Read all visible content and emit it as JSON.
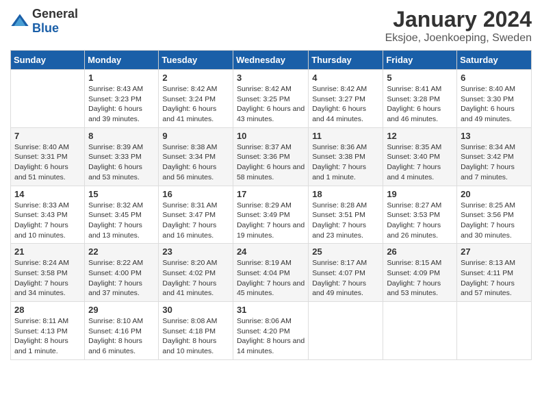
{
  "header": {
    "logo_general": "General",
    "logo_blue": "Blue",
    "month_title": "January 2024",
    "location": "Eksjoe, Joenkoeping, Sweden"
  },
  "weekdays": [
    "Sunday",
    "Monday",
    "Tuesday",
    "Wednesday",
    "Thursday",
    "Friday",
    "Saturday"
  ],
  "weeks": [
    [
      {
        "day": "",
        "sunrise": "",
        "sunset": "",
        "daylight": ""
      },
      {
        "day": "1",
        "sunrise": "Sunrise: 8:43 AM",
        "sunset": "Sunset: 3:23 PM",
        "daylight": "Daylight: 6 hours and 39 minutes."
      },
      {
        "day": "2",
        "sunrise": "Sunrise: 8:42 AM",
        "sunset": "Sunset: 3:24 PM",
        "daylight": "Daylight: 6 hours and 41 minutes."
      },
      {
        "day": "3",
        "sunrise": "Sunrise: 8:42 AM",
        "sunset": "Sunset: 3:25 PM",
        "daylight": "Daylight: 6 hours and 43 minutes."
      },
      {
        "day": "4",
        "sunrise": "Sunrise: 8:42 AM",
        "sunset": "Sunset: 3:27 PM",
        "daylight": "Daylight: 6 hours and 44 minutes."
      },
      {
        "day": "5",
        "sunrise": "Sunrise: 8:41 AM",
        "sunset": "Sunset: 3:28 PM",
        "daylight": "Daylight: 6 hours and 46 minutes."
      },
      {
        "day": "6",
        "sunrise": "Sunrise: 8:40 AM",
        "sunset": "Sunset: 3:30 PM",
        "daylight": "Daylight: 6 hours and 49 minutes."
      }
    ],
    [
      {
        "day": "7",
        "sunrise": "Sunrise: 8:40 AM",
        "sunset": "Sunset: 3:31 PM",
        "daylight": "Daylight: 6 hours and 51 minutes."
      },
      {
        "day": "8",
        "sunrise": "Sunrise: 8:39 AM",
        "sunset": "Sunset: 3:33 PM",
        "daylight": "Daylight: 6 hours and 53 minutes."
      },
      {
        "day": "9",
        "sunrise": "Sunrise: 8:38 AM",
        "sunset": "Sunset: 3:34 PM",
        "daylight": "Daylight: 6 hours and 56 minutes."
      },
      {
        "day": "10",
        "sunrise": "Sunrise: 8:37 AM",
        "sunset": "Sunset: 3:36 PM",
        "daylight": "Daylight: 6 hours and 58 minutes."
      },
      {
        "day": "11",
        "sunrise": "Sunrise: 8:36 AM",
        "sunset": "Sunset: 3:38 PM",
        "daylight": "Daylight: 7 hours and 1 minute."
      },
      {
        "day": "12",
        "sunrise": "Sunrise: 8:35 AM",
        "sunset": "Sunset: 3:40 PM",
        "daylight": "Daylight: 7 hours and 4 minutes."
      },
      {
        "day": "13",
        "sunrise": "Sunrise: 8:34 AM",
        "sunset": "Sunset: 3:42 PM",
        "daylight": "Daylight: 7 hours and 7 minutes."
      }
    ],
    [
      {
        "day": "14",
        "sunrise": "Sunrise: 8:33 AM",
        "sunset": "Sunset: 3:43 PM",
        "daylight": "Daylight: 7 hours and 10 minutes."
      },
      {
        "day": "15",
        "sunrise": "Sunrise: 8:32 AM",
        "sunset": "Sunset: 3:45 PM",
        "daylight": "Daylight: 7 hours and 13 minutes."
      },
      {
        "day": "16",
        "sunrise": "Sunrise: 8:31 AM",
        "sunset": "Sunset: 3:47 PM",
        "daylight": "Daylight: 7 hours and 16 minutes."
      },
      {
        "day": "17",
        "sunrise": "Sunrise: 8:29 AM",
        "sunset": "Sunset: 3:49 PM",
        "daylight": "Daylight: 7 hours and 19 minutes."
      },
      {
        "day": "18",
        "sunrise": "Sunrise: 8:28 AM",
        "sunset": "Sunset: 3:51 PM",
        "daylight": "Daylight: 7 hours and 23 minutes."
      },
      {
        "day": "19",
        "sunrise": "Sunrise: 8:27 AM",
        "sunset": "Sunset: 3:53 PM",
        "daylight": "Daylight: 7 hours and 26 minutes."
      },
      {
        "day": "20",
        "sunrise": "Sunrise: 8:25 AM",
        "sunset": "Sunset: 3:56 PM",
        "daylight": "Daylight: 7 hours and 30 minutes."
      }
    ],
    [
      {
        "day": "21",
        "sunrise": "Sunrise: 8:24 AM",
        "sunset": "Sunset: 3:58 PM",
        "daylight": "Daylight: 7 hours and 34 minutes."
      },
      {
        "day": "22",
        "sunrise": "Sunrise: 8:22 AM",
        "sunset": "Sunset: 4:00 PM",
        "daylight": "Daylight: 7 hours and 37 minutes."
      },
      {
        "day": "23",
        "sunrise": "Sunrise: 8:20 AM",
        "sunset": "Sunset: 4:02 PM",
        "daylight": "Daylight: 7 hours and 41 minutes."
      },
      {
        "day": "24",
        "sunrise": "Sunrise: 8:19 AM",
        "sunset": "Sunset: 4:04 PM",
        "daylight": "Daylight: 7 hours and 45 minutes."
      },
      {
        "day": "25",
        "sunrise": "Sunrise: 8:17 AM",
        "sunset": "Sunset: 4:07 PM",
        "daylight": "Daylight: 7 hours and 49 minutes."
      },
      {
        "day": "26",
        "sunrise": "Sunrise: 8:15 AM",
        "sunset": "Sunset: 4:09 PM",
        "daylight": "Daylight: 7 hours and 53 minutes."
      },
      {
        "day": "27",
        "sunrise": "Sunrise: 8:13 AM",
        "sunset": "Sunset: 4:11 PM",
        "daylight": "Daylight: 7 hours and 57 minutes."
      }
    ],
    [
      {
        "day": "28",
        "sunrise": "Sunrise: 8:11 AM",
        "sunset": "Sunset: 4:13 PM",
        "daylight": "Daylight: 8 hours and 1 minute."
      },
      {
        "day": "29",
        "sunrise": "Sunrise: 8:10 AM",
        "sunset": "Sunset: 4:16 PM",
        "daylight": "Daylight: 8 hours and 6 minutes."
      },
      {
        "day": "30",
        "sunrise": "Sunrise: 8:08 AM",
        "sunset": "Sunset: 4:18 PM",
        "daylight": "Daylight: 8 hours and 10 minutes."
      },
      {
        "day": "31",
        "sunrise": "Sunrise: 8:06 AM",
        "sunset": "Sunset: 4:20 PM",
        "daylight": "Daylight: 8 hours and 14 minutes."
      },
      {
        "day": "",
        "sunrise": "",
        "sunset": "",
        "daylight": ""
      },
      {
        "day": "",
        "sunrise": "",
        "sunset": "",
        "daylight": ""
      },
      {
        "day": "",
        "sunrise": "",
        "sunset": "",
        "daylight": ""
      }
    ]
  ]
}
